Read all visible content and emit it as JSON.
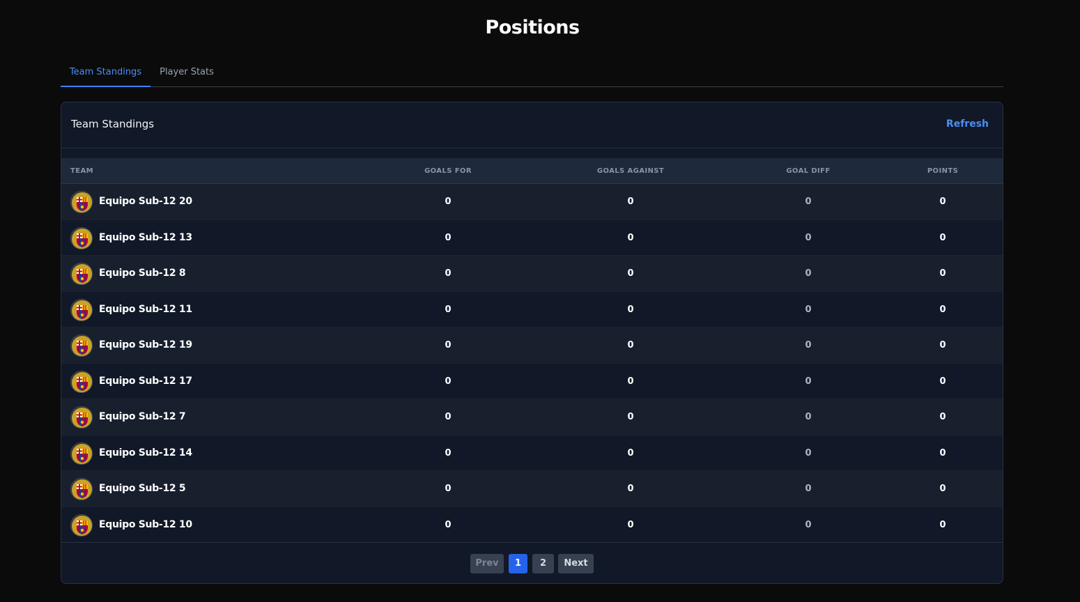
{
  "page": {
    "title": "Positions"
  },
  "tabs": [
    {
      "label": "Team Standings",
      "active": true
    },
    {
      "label": "Player Stats",
      "active": false
    }
  ],
  "card": {
    "title": "Team Standings",
    "refresh_label": "Refresh"
  },
  "table": {
    "headers": {
      "team": "TEAM",
      "goals_for": "GOALS FOR",
      "goals_against": "GOALS AGAINST",
      "goal_diff": "GOAL DIFF",
      "points": "POINTS"
    },
    "rows": [
      {
        "team": "Equipo Sub-12 20",
        "goals_for": "0",
        "goals_against": "0",
        "goal_diff": "0",
        "points": "0"
      },
      {
        "team": "Equipo Sub-12 13",
        "goals_for": "0",
        "goals_against": "0",
        "goal_diff": "0",
        "points": "0"
      },
      {
        "team": "Equipo Sub-12 8",
        "goals_for": "0",
        "goals_against": "0",
        "goal_diff": "0",
        "points": "0"
      },
      {
        "team": "Equipo Sub-12 11",
        "goals_for": "0",
        "goals_against": "0",
        "goal_diff": "0",
        "points": "0"
      },
      {
        "team": "Equipo Sub-12 19",
        "goals_for": "0",
        "goals_against": "0",
        "goal_diff": "0",
        "points": "0"
      },
      {
        "team": "Equipo Sub-12 17",
        "goals_for": "0",
        "goals_against": "0",
        "goal_diff": "0",
        "points": "0"
      },
      {
        "team": "Equipo Sub-12 7",
        "goals_for": "0",
        "goals_against": "0",
        "goal_diff": "0",
        "points": "0"
      },
      {
        "team": "Equipo Sub-12 14",
        "goals_for": "0",
        "goals_against": "0",
        "goal_diff": "0",
        "points": "0"
      },
      {
        "team": "Equipo Sub-12 5",
        "goals_for": "0",
        "goals_against": "0",
        "goal_diff": "0",
        "points": "0"
      },
      {
        "team": "Equipo Sub-12 10",
        "goals_for": "0",
        "goals_against": "0",
        "goal_diff": "0",
        "points": "0"
      }
    ]
  },
  "pagination": {
    "prev": "Prev",
    "pages": [
      "1",
      "2"
    ],
    "current": "1",
    "next": "Next"
  },
  "icons": {
    "team_crest": "club-crest-icon"
  },
  "colors": {
    "accent": "#3b82f6",
    "background": "#0b0b0c",
    "card": "#111827",
    "active_page": "#2563eb"
  }
}
